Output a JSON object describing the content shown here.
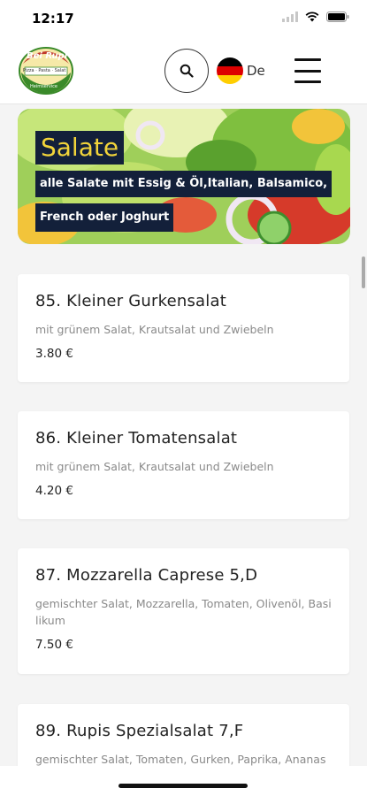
{
  "status_bar": {
    "time": "12:17"
  },
  "header": {
    "logo_text_top": "Bei Rupi",
    "logo_text_mid": "Pizza · Pasta · Salat",
    "logo_text_bottom": "Heimservice",
    "language_label": "De",
    "colors": {
      "flag": [
        "#000000",
        "#dd0000",
        "#ffce00"
      ]
    }
  },
  "banner": {
    "title": "Salate",
    "description_line1": "alle Salate mit Essig & Öl,Italian, Balsamico,",
    "description_line2": "French oder Joghurt",
    "colors": {
      "title_bg": "#13203a",
      "title_text": "#f2d43a"
    }
  },
  "menu_items": [
    {
      "title": "85. Kleiner Gurkensalat",
      "description": "mit grünem Salat, Krautsalat und Zwiebeln",
      "price": "3.80 €"
    },
    {
      "title": "86. Kleiner Tomatensalat",
      "description": "mit grünem Salat, Krautsalat und Zwiebeln",
      "price": "4.20 €"
    },
    {
      "title": "87. Mozzarella Caprese 5,D",
      "description": "gemischter Salat, Mozzarella, Tomaten, Olivenöl, Basilikum",
      "price": "7.50 €"
    },
    {
      "title": "89. Rupis Spezialsalat 7,F",
      "description": "gemischter Salat, Tomaten, Gurken, Paprika, Ananas",
      "price": ""
    }
  ]
}
